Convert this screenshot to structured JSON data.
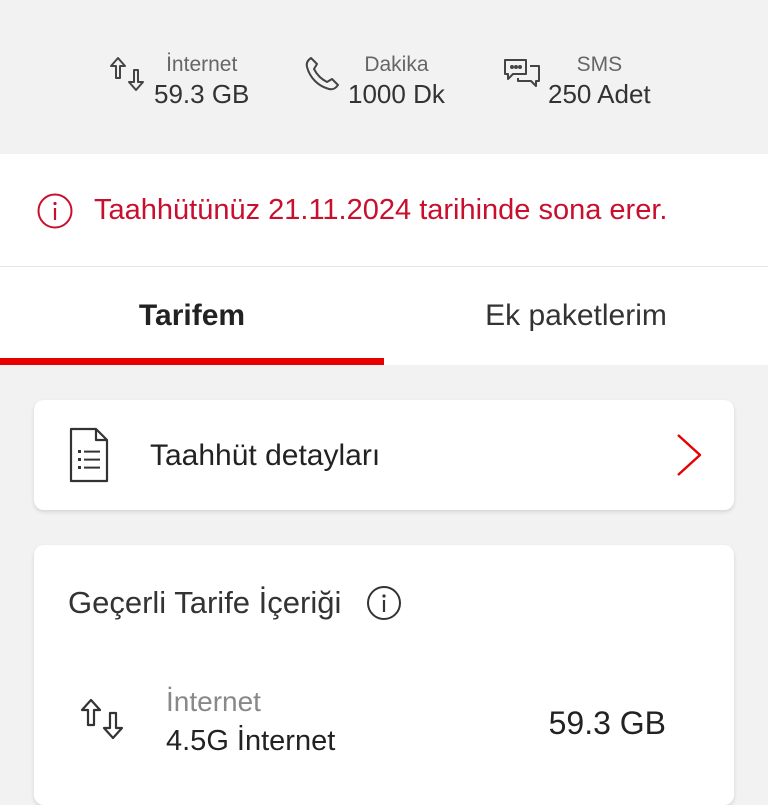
{
  "summary": {
    "items": [
      {
        "label": "İnternet",
        "value": "59.3 GB",
        "icon": "data-transfer-icon"
      },
      {
        "label": "Dakika",
        "value": "1000 Dk",
        "icon": "phone-icon"
      },
      {
        "label": "SMS",
        "value": "250 Adet",
        "icon": "chat-bubbles-icon"
      }
    ]
  },
  "banner": {
    "text": "Taahhütünüz 21.11.2024 tarihinde sona erer.",
    "color": "#c8102e"
  },
  "tabs": {
    "items": [
      {
        "label": "Tarifem",
        "active": true
      },
      {
        "label": "Ek paketlerim",
        "active": false
      }
    ],
    "underline_color": "#e60000"
  },
  "commitment_card": {
    "label": "Taahhüt detayları"
  },
  "tariff_card": {
    "title": "Geçerli Tarife İçeriği",
    "rows": [
      {
        "name": "İnternet",
        "subtitle": "4.5G İnternet",
        "value": "59.3 GB"
      }
    ]
  }
}
